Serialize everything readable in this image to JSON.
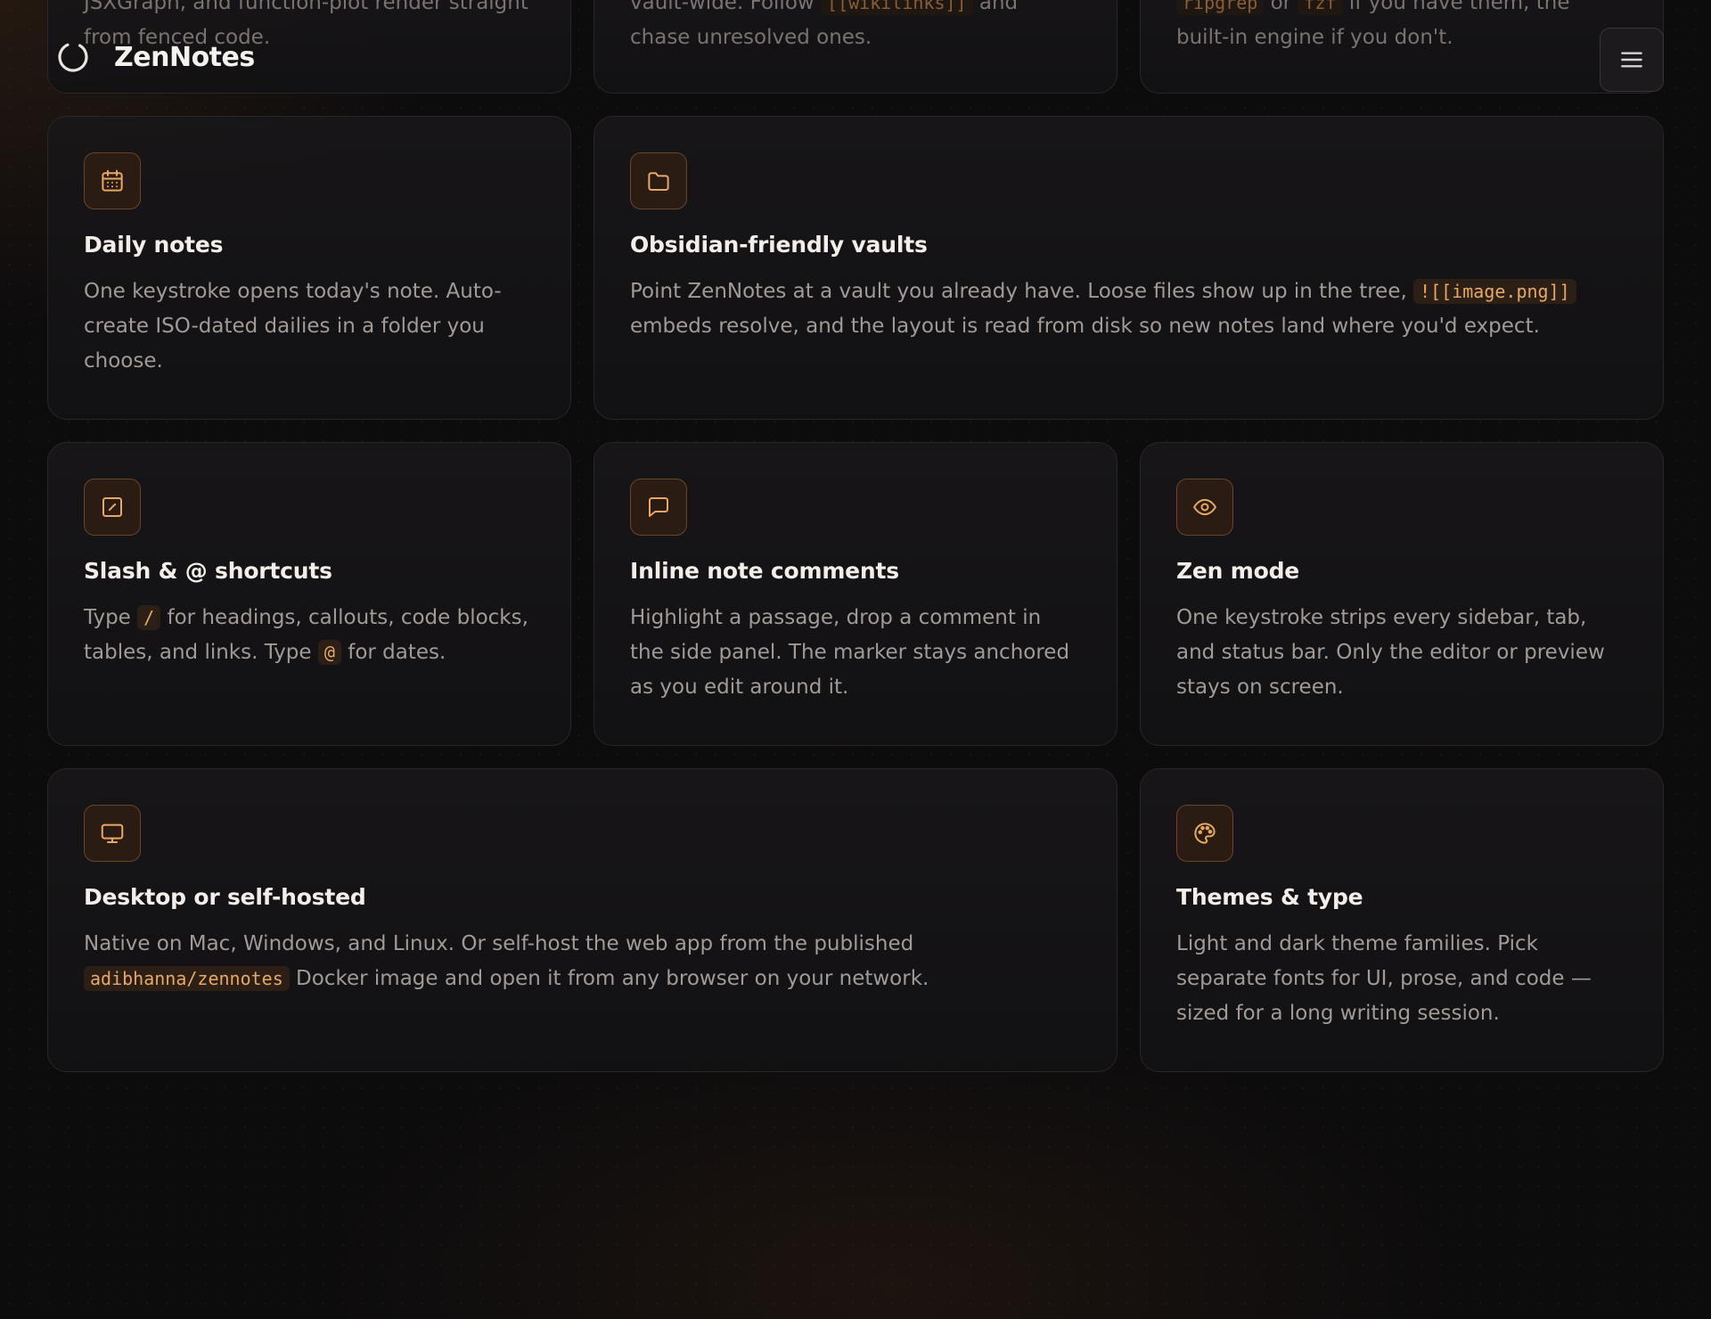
{
  "brand": {
    "name": "ZenNotes"
  },
  "nav": {
    "menu_icon": "hamburger-menu-icon"
  },
  "colors": {
    "accent": "#e7a865",
    "background": "#0d0c0d",
    "card": "#161517",
    "text": "#a19a96",
    "title": "#f3eee9"
  },
  "cards_top": [
    {
      "pre": "JSXGraph, and function-plot render straight from fenced code.",
      "code1": "",
      "mid": "",
      "code2": "",
      "post": ""
    },
    {
      "pre": "vault-wide. Follow ",
      "code1": "[[wikilinks]]",
      "mid": " and chase unresolved ones.",
      "code2": "",
      "post": ""
    },
    {
      "pre": "",
      "code1": "ripgrep",
      "mid": " or ",
      "code2": "fzf",
      "post": " if you have them, the built-in engine if you don't."
    }
  ],
  "cards": {
    "daily": {
      "icon": "calendar-icon",
      "title": "Daily notes",
      "desc": "One keystroke opens today's note. Auto-create ISO-dated dailies in a folder you choose."
    },
    "vaults": {
      "icon": "folder-icon",
      "title": "Obsidian-friendly vaults",
      "desc_pre": "Point ZenNotes at a vault you already have. Loose files show up in the tree, ",
      "code": "![[image.png]]",
      "desc_post": " embeds resolve, and the layout is read from disk so new notes land where you'd expect."
    },
    "slash": {
      "icon": "slash-square-icon",
      "title": "Slash & @ shortcuts",
      "desc_a": "Type ",
      "code1": "/",
      "desc_b": " for headings, callouts, code blocks, tables, and links. Type ",
      "code2": "@",
      "desc_c": " for dates."
    },
    "comments": {
      "icon": "message-square-icon",
      "title": "Inline note comments",
      "desc": "Highlight a passage, drop a comment in the side panel. The marker stays anchored as you edit around it."
    },
    "zen": {
      "icon": "eye-icon",
      "title": "Zen mode",
      "desc": "One keystroke strips every sidebar, tab, and status bar. Only the editor or preview stays on screen."
    },
    "desktop": {
      "icon": "monitor-icon",
      "title": "Desktop or self-hosted",
      "desc_pre": "Native on Mac, Windows, and Linux. Or self-host the web app from the published ",
      "code": "adibhanna/zennotes",
      "desc_post": " Docker image and open it from any browser on your network."
    },
    "themes": {
      "icon": "palette-icon",
      "title": "Themes & type",
      "desc": "Light and dark theme families. Pick separate fonts for UI, prose, and code — sized for a long writing session."
    }
  }
}
